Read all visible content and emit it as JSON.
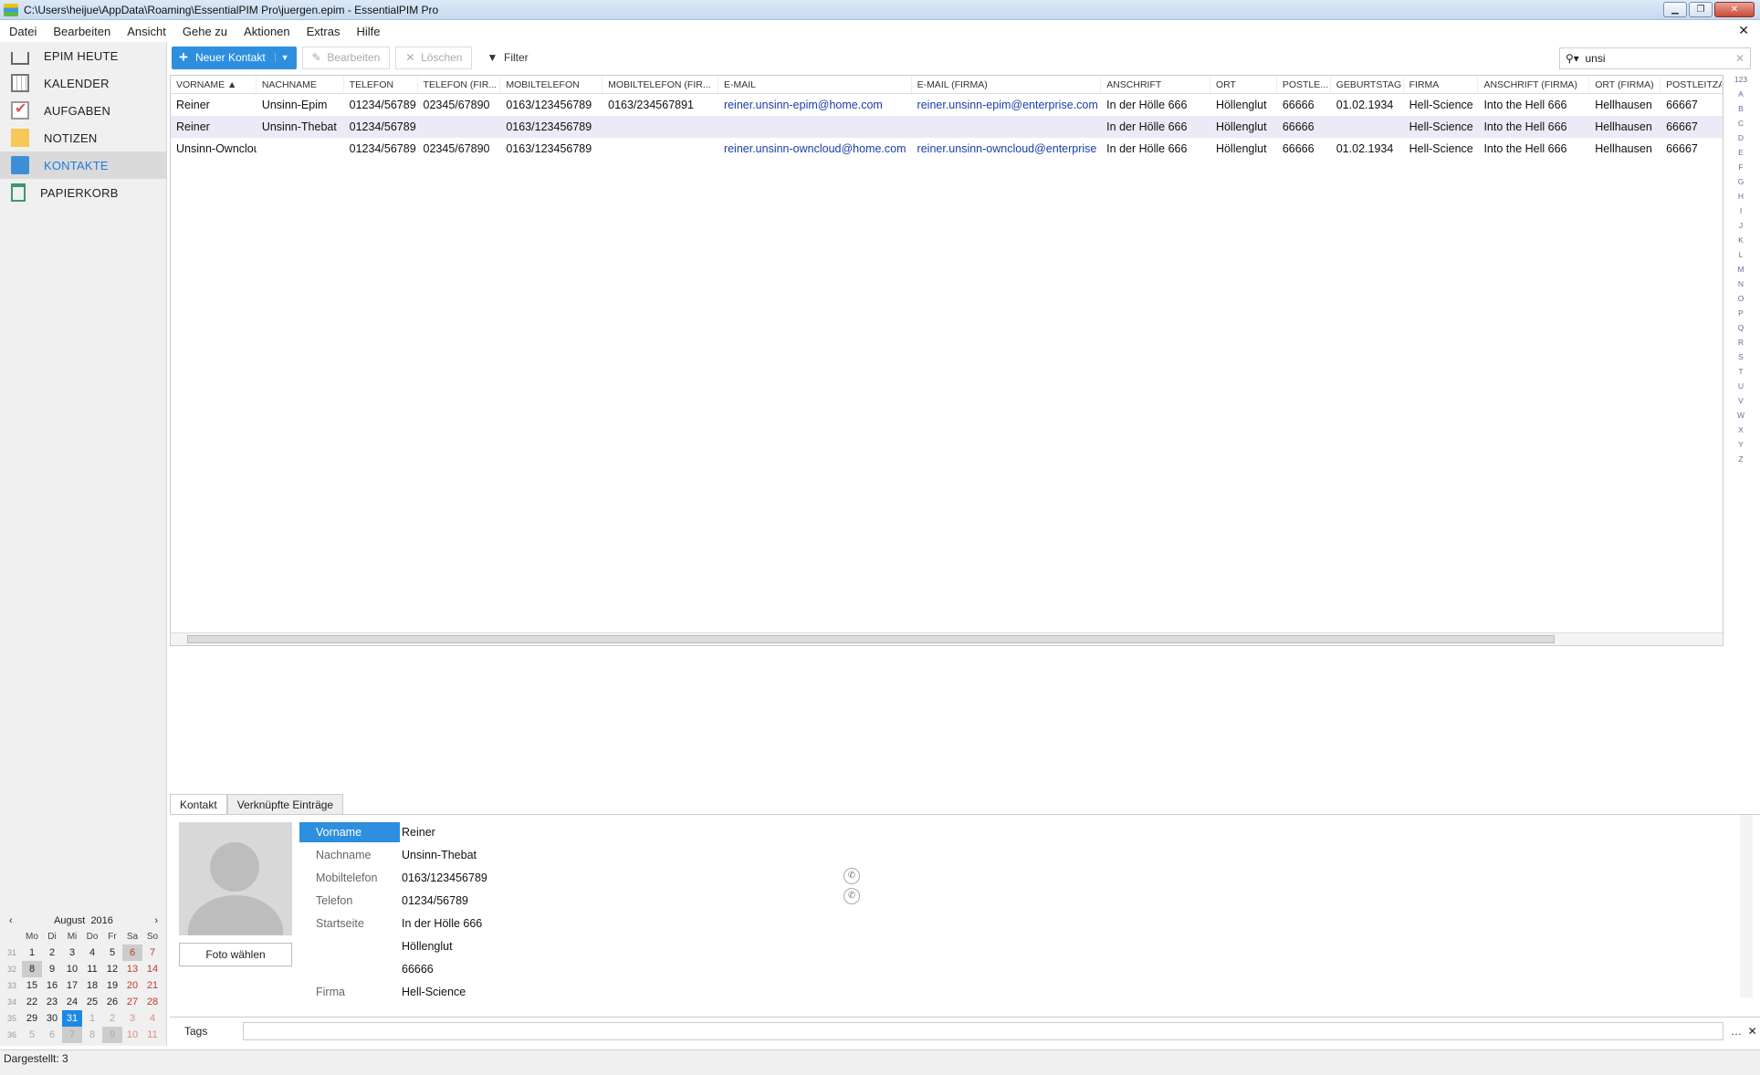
{
  "window": {
    "title": "C:\\Users\\heijue\\AppData\\Roaming\\EssentialPIM Pro\\juergen.epim - EssentialPIM Pro"
  },
  "menu": [
    "Datei",
    "Bearbeiten",
    "Ansicht",
    "Gehe zu",
    "Aktionen",
    "Extras",
    "Hilfe"
  ],
  "nav": [
    {
      "label": "EPIM HEUTE",
      "icon": "home-icon"
    },
    {
      "label": "KALENDER",
      "icon": "calendar-icon"
    },
    {
      "label": "AUFGABEN",
      "icon": "tasks-icon"
    },
    {
      "label": "NOTIZEN",
      "icon": "notes-icon"
    },
    {
      "label": "KONTAKTE",
      "icon": "contacts-icon"
    },
    {
      "label": "PAPIERKORB",
      "icon": "trash-icon"
    }
  ],
  "toolbar": {
    "new_contact": "Neuer Kontakt",
    "edit": "Bearbeiten",
    "delete": "Löschen",
    "filter": "Filter"
  },
  "search": {
    "value": "unsi"
  },
  "columns": [
    "VORNAME",
    "NACHNAME",
    "TELEFON",
    "TELEFON (FIR...",
    "MOBILTELEFON",
    "MOBILTELEFON (FIR...",
    "E-MAIL",
    "E-MAIL (FIRMA)",
    "ANSCHRIFT",
    "ORT",
    "POSTLE...",
    "GEBURTSTAG",
    "FIRMA",
    "ANSCHRIFT (FIRMA)",
    "ORT (FIRMA)",
    "POSTLEITZAH"
  ],
  "rows": [
    [
      "Reiner",
      "Unsinn-Epim",
      "01234/56789",
      "02345/67890",
      "0163/123456789",
      "0163/234567891",
      "reiner.unsinn-epim@home.com",
      "reiner.unsinn-epim@enterprise.com",
      "In der Hölle 666",
      "Höllenglut",
      "66666",
      "01.02.1934",
      "Hell-Science",
      "Into the Hell 666",
      "Hellhausen",
      "66667"
    ],
    [
      "Reiner",
      "Unsinn-Thebat",
      "01234/56789",
      "",
      "0163/123456789",
      "",
      "",
      "",
      "In der Hölle 666",
      "Höllenglut",
      "66666",
      "",
      "Hell-Science",
      "Into the Hell 666",
      "Hellhausen",
      "66667"
    ],
    [
      "Unsinn-Owncloud",
      "",
      "01234/56789",
      "02345/67890",
      "0163/123456789",
      "",
      "reiner.unsinn-owncloud@home.com",
      "reiner.unsinn-owncloud@enterprise",
      "In der Hölle 666",
      "Höllenglut",
      "66666",
      "01.02.1934",
      "Hell-Science",
      "Into the Hell 666",
      "Hellhausen",
      "66667"
    ]
  ],
  "alpha_index": [
    "123",
    "A",
    "B",
    "C",
    "D",
    "E",
    "F",
    "G",
    "H",
    "I",
    "J",
    "K",
    "L",
    "M",
    "N",
    "O",
    "P",
    "Q",
    "R",
    "S",
    "T",
    "U",
    "V",
    "W",
    "X",
    "Y",
    "Z"
  ],
  "detail_tabs": [
    "Kontakt",
    "Verknüpfte Einträge"
  ],
  "photo_button": "Foto wählen",
  "detail": [
    {
      "label": "Vorname",
      "value": "Reiner"
    },
    {
      "label": "Nachname",
      "value": "Unsinn-Thebat"
    },
    {
      "label": "Mobiltelefon",
      "value": "0163/123456789"
    },
    {
      "label": "Telefon",
      "value": "01234/56789"
    },
    {
      "label": "Startseite",
      "value": "In der Hölle 666"
    },
    {
      "label": "",
      "value": "Höllenglut"
    },
    {
      "label": "",
      "value": "66666"
    },
    {
      "label": "Firma",
      "value": "Hell-Science"
    }
  ],
  "tags_label": "Tags",
  "calendar": {
    "month": "August",
    "year": "2016",
    "weekdays": [
      "Mo",
      "Di",
      "Mi",
      "Do",
      "Fr",
      "Sa",
      "So"
    ],
    "weeks": [
      {
        "wk": "31",
        "days": [
          "1",
          "2",
          "3",
          "4",
          "5",
          "6",
          "7"
        ]
      },
      {
        "wk": "32",
        "days": [
          "8",
          "9",
          "10",
          "11",
          "12",
          "13",
          "14"
        ]
      },
      {
        "wk": "33",
        "days": [
          "15",
          "16",
          "17",
          "18",
          "19",
          "20",
          "21"
        ]
      },
      {
        "wk": "34",
        "days": [
          "22",
          "23",
          "24",
          "25",
          "26",
          "27",
          "28"
        ]
      },
      {
        "wk": "35",
        "days": [
          "29",
          "30",
          "31",
          "1",
          "2",
          "3",
          "4"
        ]
      },
      {
        "wk": "36",
        "days": [
          "5",
          "6",
          "7",
          "8",
          "9",
          "10",
          "11"
        ]
      }
    ]
  },
  "status": "Dargestellt: 3"
}
